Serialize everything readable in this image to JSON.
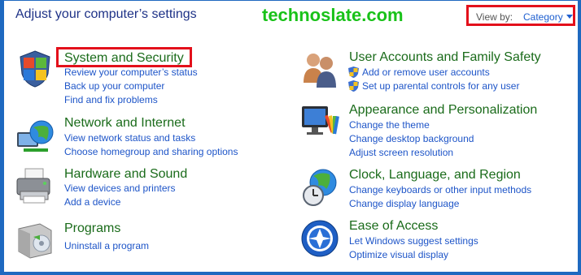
{
  "header": {
    "title": "Adjust your computer’s settings",
    "watermark": "technoslate.com",
    "view_by_label": "View by:",
    "view_by_value": "Category"
  },
  "categories": [
    {
      "title": "System and Security",
      "icon": "shield-flag-icon",
      "links": [
        "Review your computer’s status",
        "Back up your computer",
        "Find and fix problems"
      ]
    },
    {
      "title": "Network and Internet",
      "icon": "network-globe-icon",
      "links": [
        "View network status and tasks",
        "Choose homegroup and sharing options"
      ]
    },
    {
      "title": "Hardware and Sound",
      "icon": "printer-icon",
      "links": [
        "View devices and printers",
        "Add a device"
      ]
    },
    {
      "title": "Programs",
      "icon": "programs-box-icon",
      "links": [
        "Uninstall a program"
      ]
    },
    {
      "title": "User Accounts and Family Safety",
      "icon": "users-icon",
      "links": [
        "Add or remove user accounts",
        "Set up parental controls for any user"
      ]
    },
    {
      "title": "Appearance and Personalization",
      "icon": "monitor-palette-icon",
      "links": [
        "Change the theme",
        "Change desktop background",
        "Adjust screen resolution"
      ]
    },
    {
      "title": "Clock, Language, and Region",
      "icon": "globe-clock-icon",
      "links": [
        "Change keyboards or other input methods",
        "Change display language"
      ]
    },
    {
      "title": "Ease of Access",
      "icon": "ease-of-access-icon",
      "links": [
        "Let Windows suggest settings",
        "Optimize visual display"
      ]
    }
  ],
  "colors": {
    "title_green": "#1a6b1a",
    "link_blue": "#1e55c8",
    "highlight_red": "#e3101b",
    "frame_blue": "#1e69c0"
  }
}
